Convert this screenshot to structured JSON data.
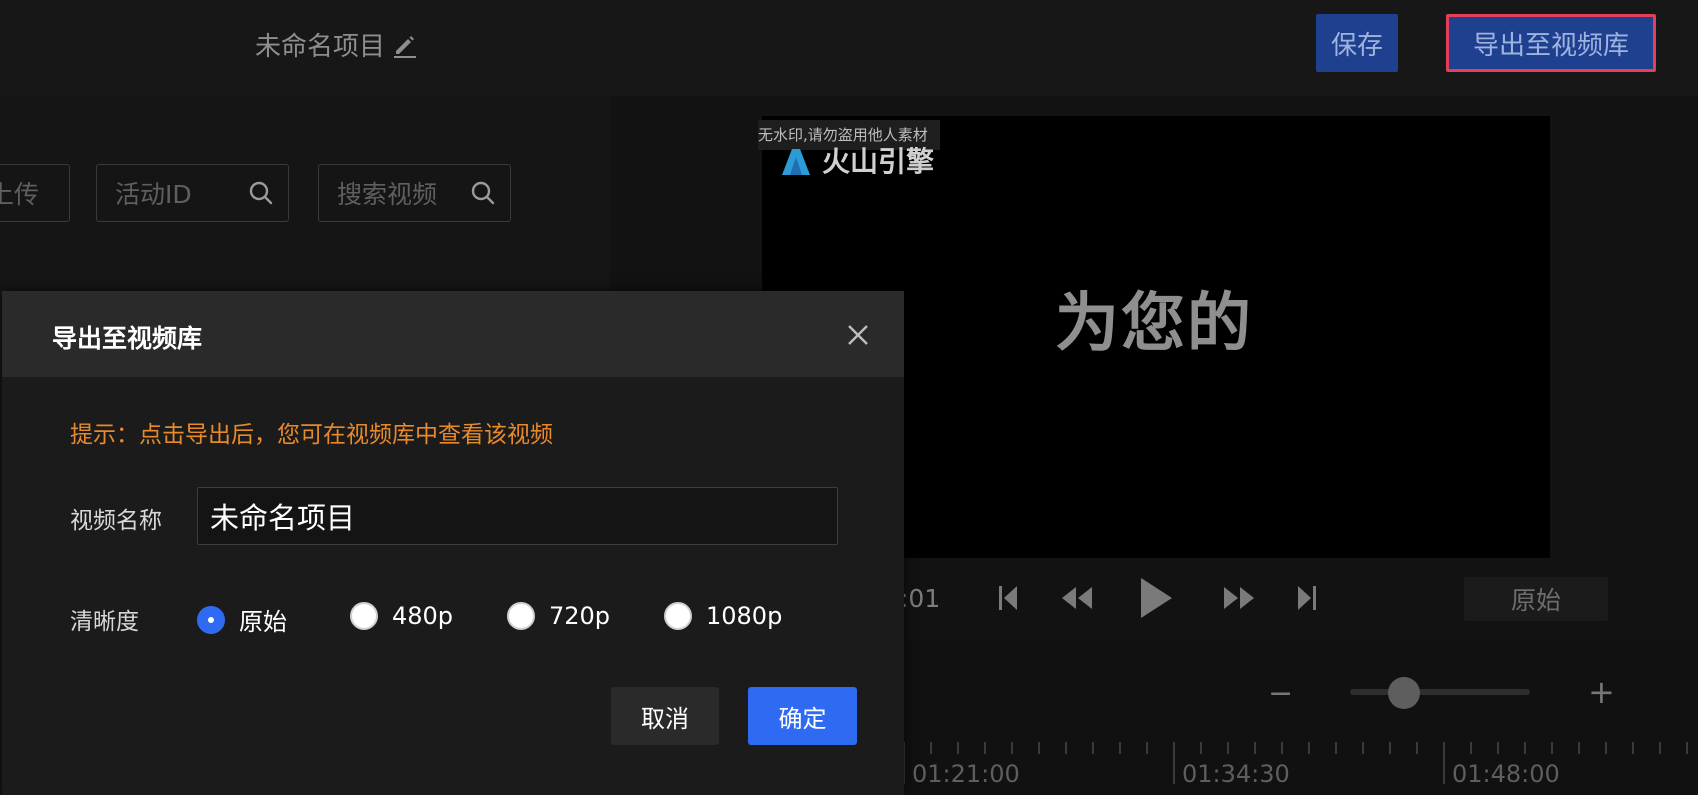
{
  "header": {
    "project_title": "未命名项目",
    "save_label": "保存",
    "export_label": "导出至视频库"
  },
  "left_panel": {
    "upload_label": "上传",
    "activity_search_placeholder": "活动ID",
    "video_search_placeholder": "搜索视频"
  },
  "preview": {
    "watermark_notice": "无水印,请勿盗用他人素材",
    "brand": "火山引擎",
    "subtitle": "为您的",
    "current_time": ":01",
    "quality_label": "原始"
  },
  "timeline": {
    "zoom_level": 0.3,
    "ticks": [
      "01:21:00",
      "01:34:30",
      "01:48:00"
    ]
  },
  "dialog": {
    "title": "导出至视频库",
    "tip": "提示：点击导出后，您可在视频库中查看该视频",
    "name_label": "视频名称",
    "name_value": "未命名项目",
    "quality_label": "清晰度",
    "quality_options": [
      "原始",
      "480p",
      "720p",
      "1080p"
    ],
    "selected_quality": "原始",
    "cancel_label": "取消",
    "confirm_label": "确定"
  },
  "colors": {
    "accent_blue": "#2f6bf2",
    "tip_orange": "#e8892a",
    "highlight_red": "#e0405a"
  }
}
